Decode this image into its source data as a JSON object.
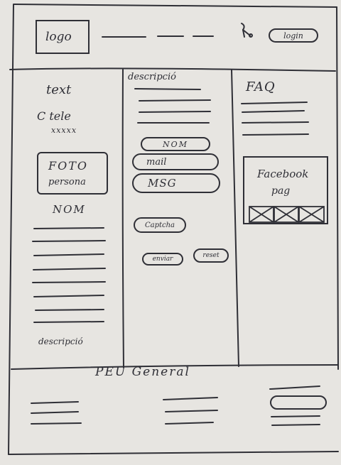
{
  "header": {
    "logo": "logo",
    "login": "login"
  },
  "left_column": {
    "text_label": "text",
    "telephone": "C tele",
    "telephone_value": "xxxxx",
    "photo_line1": "FOTO",
    "photo_line2": "persona",
    "name_label": "NOM",
    "footer_label": "descripció"
  },
  "middle_column": {
    "title": "descripció",
    "fields": [
      "NOM",
      "mail",
      "MSG"
    ],
    "captcha": "Captcha",
    "buttons": [
      "enviar",
      "reset"
    ]
  },
  "right_column": {
    "faq_title": "FAQ",
    "facebook_line1": "Facebook",
    "facebook_line2": "pag"
  },
  "footer": {
    "title": "PEU General"
  }
}
